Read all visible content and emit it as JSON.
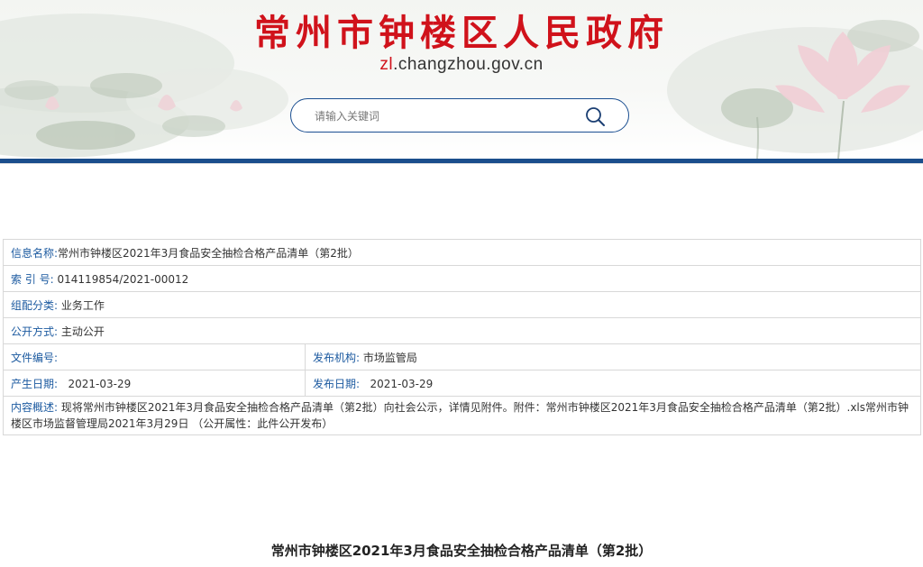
{
  "site": {
    "title": "常州市钟楼区人民政府",
    "domain_prefix": "zl",
    "domain_rest": ".changzhou.gov.cn",
    "accent_red": "#d0121b",
    "accent_blue": "#1b4e8c"
  },
  "search": {
    "placeholder": "请输入关键词",
    "icon": "search-icon"
  },
  "info": {
    "name_label": "信息名称:",
    "name_value": "常州市钟楼区2021年3月食品安全抽检合格产品清单（第2批）",
    "index_label": "索 引 号:",
    "index_value": "014119854/2021-00012",
    "category_label": "组配分类:",
    "category_value": "业务工作",
    "open_label": "公开方式:",
    "open_value": "主动公开",
    "docno_label": "文件编号:",
    "docno_value": "",
    "publisher_label": "发布机构:",
    "publisher_value": "市场监管局",
    "created_label": "产生日期:",
    "created_value": "2021-03-29",
    "published_label": "发布日期:",
    "published_value": "2021-03-29",
    "summary_label": "内容概述:",
    "summary_value": "现将常州市钟楼区2021年3月食品安全抽检合格产品清单（第2批）向社会公示，详情见附件。附件：常州市钟楼区2021年3月食品安全抽检合格产品清单（第2批）.xls常州市钟楼区市场监督管理局2021年3月29日 （公开属性：此件公开发布）"
  },
  "document": {
    "title": "常州市钟楼区2021年3月食品安全抽检合格产品清单（第2批）"
  }
}
